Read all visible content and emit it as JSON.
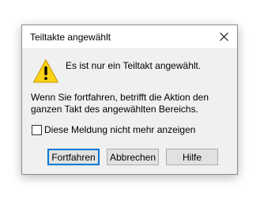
{
  "dialog": {
    "title": "Teiltakte angewählt",
    "close_icon": "close-icon",
    "warning_icon": "warning-icon",
    "message": "Es ist nur ein Teiltakt angewählt.",
    "detail": "Wenn Sie fortfahren, betrifft die Aktion den ganzen Takt des angewählten Bereichs.",
    "checkbox_label": "Diese Meldung nicht mehr anzeigen",
    "checkbox_checked": false,
    "buttons": {
      "continue": "Fortfahren",
      "cancel": "Abbrechen",
      "help": "Hilfe"
    },
    "colors": {
      "warning_fill": "#fcd116",
      "default_button_border": "#0078d7",
      "button_bg": "#e1e1e1",
      "dialog_bg": "#f0f0f0"
    }
  }
}
